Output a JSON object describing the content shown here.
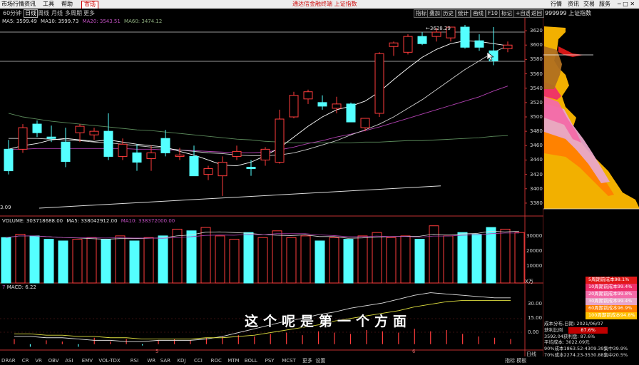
{
  "menubar": {
    "items": [
      "市场行情",
      "资讯",
      "工具",
      "帮助"
    ],
    "tab_active": "市场",
    "title": "通达信金融终端 上证指数",
    "right_items": [
      "行情",
      "资讯",
      "交易",
      "服务"
    ]
  },
  "toolbar": {
    "periods": [
      "60分钟",
      "日线",
      "周线",
      "月线",
      "多周期",
      "更多"
    ],
    "tools": [
      "指标",
      "叠加",
      "历史",
      "统计",
      "画线",
      "F10",
      "标记",
      "+自选",
      "返回"
    ],
    "stock": "999999 上证指数"
  },
  "main_panel": {
    "ma_label_ma5": "MA5: 3599.49",
    "ma_label_ma10": "MA10: 3599.73",
    "ma_label_ma20": "MA20: 3543.51",
    "ma_label_ma60": "MA60: 3474.12",
    "high_label": "3628.29",
    "low_label": "3.09"
  },
  "price_axis": [
    "3620",
    "3600",
    "3580",
    "3560",
    "3540",
    "3520",
    "3500",
    "3480",
    "3460",
    "3440",
    "3420",
    "3400",
    "3380"
  ],
  "volume_panel": {
    "label_vol": "VOLUME: 303718688.00",
    "label_ma5": "MA5: 338042912.00",
    "label_ma10": "MA10: 338372000.00",
    "axis": [
      "30000",
      "20000",
      "10000"
    ],
    "unit": "X万"
  },
  "macd_panel": {
    "label": "MACD: 6.22",
    "axis": [
      "30.00",
      "15.00",
      "0.00"
    ]
  },
  "date_labels": [
    "5",
    "6"
  ],
  "chart_data": {
    "type": "candlestick",
    "ylim": [
      3370,
      3630
    ],
    "ohlc": [
      [
        3455,
        3468,
        3420,
        3425
      ],
      [
        3455,
        3490,
        3450,
        3485
      ],
      [
        3490,
        3495,
        3472,
        3478
      ],
      [
        3472,
        3488,
        3465,
        3470
      ],
      [
        3465,
        3485,
        3430,
        3438
      ],
      [
        3478,
        3490,
        3465,
        3487
      ],
      [
        3475,
        3485,
        3468,
        3480
      ],
      [
        3480,
        3505,
        3440,
        3445
      ],
      [
        3445,
        3470,
        3440,
        3462
      ],
      [
        3450,
        3462,
        3425,
        3437
      ],
      [
        3442,
        3460,
        3425,
        3450
      ],
      [
        3470,
        3482,
        3445,
        3450
      ],
      [
        3445,
        3457,
        3440,
        3447
      ],
      [
        3445,
        3460,
        3418,
        3418
      ],
      [
        3420,
        3432,
        3412,
        3428
      ],
      [
        3418,
        3445,
        3390,
        3437
      ],
      [
        3445,
        3460,
        3440,
        3452
      ],
      [
        3430,
        3440,
        3418,
        3428
      ],
      [
        3440,
        3458,
        3432,
        3455
      ],
      [
        3437,
        3510,
        3435,
        3497
      ],
      [
        3500,
        3535,
        3498,
        3530
      ],
      [
        3525,
        3538,
        3518,
        3535
      ],
      [
        3520,
        3530,
        3510,
        3515
      ],
      [
        3512,
        3528,
        3505,
        3518
      ],
      [
        3518,
        3520,
        3495,
        3493
      ],
      [
        3485,
        3498,
        3480,
        3498
      ],
      [
        3505,
        3590,
        3500,
        3588
      ],
      [
        3598,
        3605,
        3585,
        3603
      ],
      [
        3590,
        3615,
        3587,
        3612
      ],
      [
        3612,
        3618,
        3600,
        3602
      ],
      [
        3612,
        3624,
        3605,
        3618
      ],
      [
        3610,
        3625,
        3605,
        3625
      ],
      [
        3625,
        3628,
        3595,
        3597
      ],
      [
        3606,
        3615,
        3592,
        3597
      ],
      [
        3592,
        3625,
        3572,
        3578
      ],
      [
        3595,
        3605,
        3590,
        3600
      ]
    ],
    "ma5": [
      3455,
      3460,
      3463,
      3468,
      3470,
      3468,
      3466,
      3468,
      3465,
      3462,
      3460,
      3458,
      3452,
      3447,
      3440,
      3433,
      3432,
      3437,
      3446,
      3457,
      3472,
      3487,
      3500,
      3510,
      3515,
      3522,
      3535,
      3552,
      3568,
      3583,
      3594,
      3602,
      3606,
      3605,
      3602,
      3599
    ],
    "ma10": [
      3470,
      3470,
      3470,
      3469,
      3468,
      3467,
      3465,
      3464,
      3462,
      3460,
      3458,
      3456,
      3454,
      3452,
      3450,
      3449,
      3447,
      3446,
      3446,
      3447,
      3450,
      3455,
      3461,
      3467,
      3475,
      3482,
      3490,
      3500,
      3512,
      3524,
      3538,
      3552,
      3566,
      3578,
      3590,
      3599
    ],
    "ma20": [
      3455,
      3455,
      3456,
      3456,
      3456,
      3456,
      3456,
      3456,
      3456,
      3455,
      3455,
      3454,
      3454,
      3453,
      3452,
      3451,
      3450,
      3450,
      3451,
      3454,
      3458,
      3463,
      3467,
      3472,
      3476,
      3481,
      3486,
      3492,
      3498,
      3504,
      3510,
      3516,
      3522,
      3528,
      3536,
      3543
    ],
    "ma60": [
      3505,
      3500,
      3497,
      3494,
      3492,
      3490,
      3488,
      3486,
      3484,
      3482,
      3481,
      3479,
      3477,
      3475,
      3473,
      3471,
      3469,
      3468,
      3466,
      3465,
      3464,
      3464,
      3464,
      3464,
      3464,
      3465,
      3465,
      3466,
      3467,
      3467,
      3468,
      3469,
      3470,
      3471,
      3473,
      3474
    ],
    "trendline": [
      3373,
      3404
    ],
    "volume": [
      27000,
      29000,
      28000,
      26000,
      25000,
      26000,
      27000,
      26000,
      28000,
      25000,
      27000,
      28000,
      32000,
      31000,
      33000,
      28000,
      26000,
      30000,
      27000,
      31000,
      27000,
      28000,
      25000,
      27000,
      26000,
      28000,
      30000,
      27000,
      28000,
      26000,
      34000,
      28000,
      30000,
      29000,
      33000,
      32000,
      30000
    ],
    "volume_ylim": [
      0,
      36000
    ],
    "macd_ylim": [
      -4,
      42
    ],
    "macd_dif": [
      6,
      6,
      5,
      5,
      4,
      3,
      3,
      2,
      2,
      3,
      3,
      3,
      4,
      6,
      9,
      12,
      15,
      18,
      20,
      23,
      25,
      28,
      30,
      32,
      35,
      38,
      40,
      39,
      38,
      37,
      36,
      36
    ],
    "macd_dea": [
      8,
      8,
      7,
      7,
      6,
      6,
      5,
      5,
      4,
      4,
      4,
      4,
      5,
      5,
      6,
      7,
      9,
      11,
      13,
      15,
      18,
      20,
      22,
      24,
      26,
      29,
      31,
      33,
      34,
      34,
      34,
      34
    ],
    "macd_bar": [
      4,
      -2,
      3,
      2,
      -2,
      5,
      2,
      4,
      -1,
      3,
      4,
      3,
      5,
      6,
      7,
      6,
      8,
      9,
      7,
      10,
      9,
      8,
      11,
      10,
      9,
      12,
      10,
      11,
      8,
      6,
      5,
      4
    ]
  },
  "cost_distribution": {
    "title": "成本分布,日期: 2021/06/07",
    "profit_label": "获利比例",
    "profit_value": "87.6%",
    "profit_price": "3592.04获利盘: 87.6%",
    "avg_cost": "平均成本: 3022.09元",
    "c90": "90%成本1863.52-4309.39集中39.9%",
    "c70": "70%成本2274.23-3530.88集中20.5%",
    "legend": [
      "5周期前成本98.1%",
      "10周期前成本99.4%",
      "20周期前成本99.8%",
      "30周期前成本99.4%",
      "60周期前成本96.9%",
      "100周期前成本94.8%"
    ],
    "legend_colors": [
      "#e01818",
      "#ee2f6a",
      "#f36aa8",
      "#e8a6c9",
      "#ff7f00",
      "#ffc000"
    ],
    "base_color": "#f2b000"
  },
  "subtitle": "这个呢是第一个方面",
  "bottom_tabs": [
    "DRAR",
    "CR",
    "VR",
    "OBV",
    "ASI",
    "EMV",
    "VOL-TDX",
    "RSI",
    "WR",
    "SAR",
    "KDJ",
    "CCI",
    "ROC",
    "MTM",
    "BOLL",
    "PSY",
    "MCST",
    "更多",
    "设置"
  ],
  "bottom_right": [
    "指标",
    "模板"
  ],
  "bottom_right_small": "日线"
}
